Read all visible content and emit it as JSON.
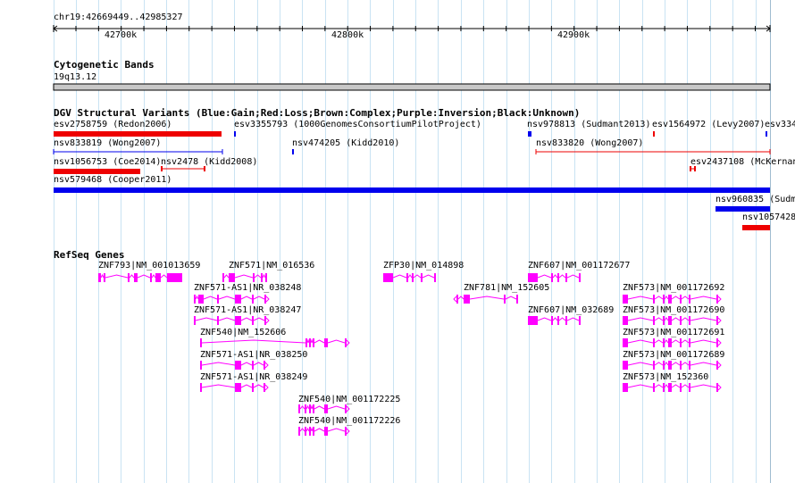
{
  "ruler": {
    "location": "chr19:42669449..42985327",
    "ticks": [
      "42700k",
      "42800k",
      "42900k"
    ]
  },
  "tracks": {
    "cytoband": {
      "title": "Cytogenetic Bands",
      "band": "19q13.12"
    },
    "dgv": {
      "title": "DGV Structural Variants (Blue:Gain;Red:Loss;Brown:Complex;Purple:Inversion;Black:Unknown)",
      "colors": {
        "gain": "#0000ee",
        "loss": "#ee0000"
      },
      "features": [
        {
          "label": "esv2758759 (Redon2006)",
          "type": "loss"
        },
        {
          "label": "esv3355793 (1000GenomesConsortiumPilotProject)",
          "type": "gain"
        },
        {
          "label": "nsv978813 (Sudmant2013)",
          "type": "gain"
        },
        {
          "label": "esv1564972 (Levy2007)",
          "type": "loss"
        },
        {
          "label": "esv334",
          "type": "gain"
        },
        {
          "label": "nsv833819 (Wong2007)",
          "type": "gain"
        },
        {
          "label": "nsv474205 (Kidd2010)",
          "type": "gain"
        },
        {
          "label": "nsv833820 (Wong2007)",
          "type": "loss"
        },
        {
          "label": "nsv1056753 (Coe2014)",
          "type": "loss"
        },
        {
          "label": "nsv2478 (Kidd2008)",
          "type": "loss"
        },
        {
          "label": "esv2437108 (McKernan",
          "type": "loss"
        },
        {
          "label": "nsv579468 (Cooper2011)",
          "type": "gain"
        },
        {
          "label": "nsv960835 (Sudm",
          "type": "gain"
        },
        {
          "label": "nsv1057428",
          "type": "loss"
        }
      ]
    },
    "refseq": {
      "title": "RefSeq Genes",
      "color": "#ff00ff",
      "genes": [
        "ZNF793|NM_001013659",
        "ZNF571|NM_016536",
        "ZFP30|NM_014898",
        "ZNF607|NM_001172677",
        "ZNF571-AS1|NR_038248",
        "ZNF781|NM_152605",
        "ZNF573|NM_001172692",
        "ZNF571-AS1|NR_038247",
        "ZNF607|NM_032689",
        "ZNF573|NM_001172690",
        "ZNF540|NM_152606",
        "ZNF573|NM_001172691",
        "ZNF571-AS1|NR_038250",
        "ZNF573|NM_001172689",
        "ZNF571-AS1|NR_038249",
        "ZNF573|NM_152360",
        "ZNF540|NM_001172225",
        "ZNF540|NM_001172226"
      ]
    }
  }
}
